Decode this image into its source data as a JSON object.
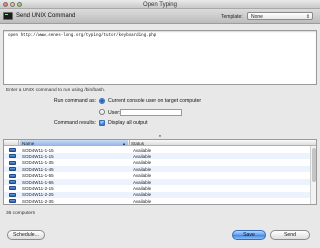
{
  "window": {
    "title": "Open Typing"
  },
  "command_bar": {
    "title": "Send UNIX Command",
    "template_label": "Template:",
    "template_value": "None"
  },
  "command": {
    "text": "open http://www.senes-long.org/typing/tutor/keyboarding.php"
  },
  "hint": "Enter a UNIX command to run using /bin/bash.",
  "run_as": {
    "label": "Run command as:",
    "option_console": "Current console user on target computer",
    "option_user": "User:",
    "user_value": ""
  },
  "results": {
    "label": "Command results:",
    "display_all_label": "Display all output",
    "display_all_checked": true
  },
  "table": {
    "columns": [
      "Name",
      "Status"
    ],
    "rows": [
      {
        "name": "SOD4W11-1-15",
        "status": "Available"
      },
      {
        "name": "SOD4W11-1-15",
        "status": "Available"
      },
      {
        "name": "SOD4W11-1-35",
        "status": "Available"
      },
      {
        "name": "SOD4W11-1-45",
        "status": "Available"
      },
      {
        "name": "SOD4W11-1-55",
        "status": "Available"
      },
      {
        "name": "SOD4W11-1-65",
        "status": "Available"
      },
      {
        "name": "SOD4W11-2-15",
        "status": "Available"
      },
      {
        "name": "SOD4W11-2-25",
        "status": "Available"
      },
      {
        "name": "SOD4W11-2-35",
        "status": "Available"
      }
    ]
  },
  "footer": {
    "count_text": "36 computers",
    "schedule_label": "Schedule...",
    "save_label": "Save",
    "send_label": "Send"
  },
  "colors": {
    "accent": "#3e86e8",
    "selected_header": "#8fb3e6",
    "alt_row": "#edf3fe"
  }
}
